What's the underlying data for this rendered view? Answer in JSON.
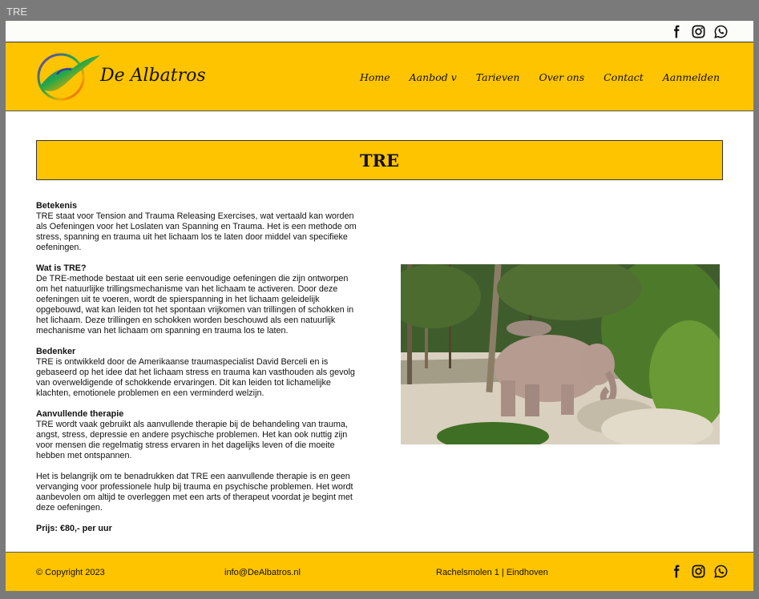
{
  "window": {
    "title": "TRE"
  },
  "header": {
    "brand": "De Albatros",
    "nav": [
      "Home",
      "Aanbod  v",
      "Tarieven",
      "Over ons",
      "Contact",
      "Aanmelden"
    ]
  },
  "social": [
    "facebook-icon",
    "instagram-icon",
    "whatsapp-icon"
  ],
  "page": {
    "title": "TRE",
    "sections": [
      {
        "heading": "Betekenis",
        "body": "TRE staat voor Tension and Trauma Releasing Exercises, wat vertaald kan worden als Oefeningen voor het Loslaten van Spanning en Trauma. Het is een methode om stress, spanning en trauma uit het lichaam los te laten door middel van specifieke oefeningen."
      },
      {
        "heading": "Wat is TRE?",
        "body": "De TRE-methode bestaat uit een serie eenvoudige oefeningen die zijn ontworpen om het natuurlijke trillingsmechanisme van het lichaam te activeren. Door deze oefeningen uit te voeren, wordt de spierspanning in het lichaam geleidelijk opgebouwd, wat kan leiden tot het spontaan vrijkomen van trillingen of schokken in het lichaam. Deze trillingen en schokken worden beschouwd als een natuurlijk mechanisme van het lichaam om spanning en trauma los te laten."
      },
      {
        "heading": "Bedenker",
        "body": "TRE is ontwikkeld door de Amerikaanse traumaspecialist David Berceli en is gebaseerd op het idee dat het lichaam stress en trauma kan vasthouden als gevolg van overweldigende of schokkende ervaringen. Dit kan leiden tot lichamelijke klachten, emotionele problemen en een verminderd welzijn."
      },
      {
        "heading": "Aanvullende therapie",
        "body": "TRE wordt vaak gebruikt als aanvullende therapie bij de behandeling van trauma, angst, stress, depressie en andere psychische problemen. Het kan ook nuttig zijn voor mensen die regelmatig stress ervaren in het dagelijks leven of die moeite hebben met ontspannen."
      },
      {
        "heading": "",
        "body": "Het is belangrijk om te benadrukken dat TRE een aanvullende therapie is en geen vervanging voor professionele hulp bij trauma en psychische problemen. Het wordt aanbevolen om altijd te overleggen met een arts of therapeut voordat je begint met deze oefeningen."
      }
    ],
    "price": "Prijs: €80,- per uur"
  },
  "footer": {
    "copyright": "© Copyright 2023",
    "email": "info@DeAlbatros.nl",
    "address": "Rachelsmolen 1 | Eindhoven"
  },
  "colors": {
    "accent": "#ffc400",
    "text": "#111111"
  }
}
